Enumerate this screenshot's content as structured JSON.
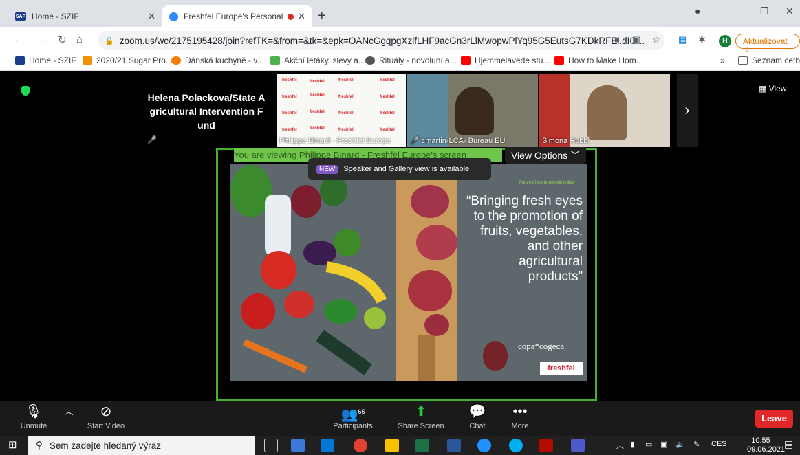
{
  "browser": {
    "tabs": [
      {
        "label": "Home - SZIF",
        "active": false
      },
      {
        "label": "Freshfel Europe's Personal M",
        "active": true
      }
    ],
    "new_tab": "+",
    "url": "zoom.us/wc/2175195428/join?refTK=&from=&tk=&epk=OANcGgqpgXzlfLHF9acGn3rLlMwopwPlYq95G5EutsG7KDkRFEl.dIG...",
    "profile_initial": "H",
    "update_label": "Aktualizovat",
    "bookmarks": [
      "Home - SZIF",
      "2020/21 Sugar Pro...",
      "Dánská kuchyně - v...",
      "Akční letáky, slevy a...",
      "Rituály - novoluní a...",
      "Hjemmelavede stu...",
      "How to Make Hom..."
    ],
    "reading_list": "Seznam četby",
    "overflow": "»"
  },
  "meeting": {
    "participants_tiles": [
      {
        "name_line1": "Helena Polackova/State A",
        "name_line2": "gricultural Intervention F",
        "name_line3": "und"
      },
      {
        "name": "Philippe Binard - Freshfel Europe"
      },
      {
        "name": "cmartin-LCA- Bureau EU"
      },
      {
        "name": "Simona Rubbi"
      }
    ],
    "view_label": "View",
    "banner_text": "You are viewing Philippe Binard - Freshfel Europe's screen",
    "view_options": "View Options",
    "tooltip_badge": "NEW",
    "tooltip_text": "Speaker and Gallery view is available",
    "slide": {
      "quote": "“Bringing fresh eyes to the promotion of fruits, vegetables, and other agricultural products”",
      "logo1": "copa*cogeca",
      "logo2": "freshfel",
      "small_tag": "Future of the promotion policy"
    }
  },
  "controls": {
    "unmute": "Unmute",
    "start_video": "Start Video",
    "participants": "Participants",
    "participants_count": "65",
    "share_screen": "Share Screen",
    "chat": "Chat",
    "more": "More",
    "leave": "Leave"
  },
  "taskbar": {
    "search_placeholder": "Sem zadejte hledaný výraz",
    "lang": "CES",
    "time": "10:55",
    "date": "09.06.2021"
  },
  "colors": {
    "zoom_green": "#44b12e",
    "leave_red": "#e02828",
    "chrome_update": "#e37400"
  }
}
